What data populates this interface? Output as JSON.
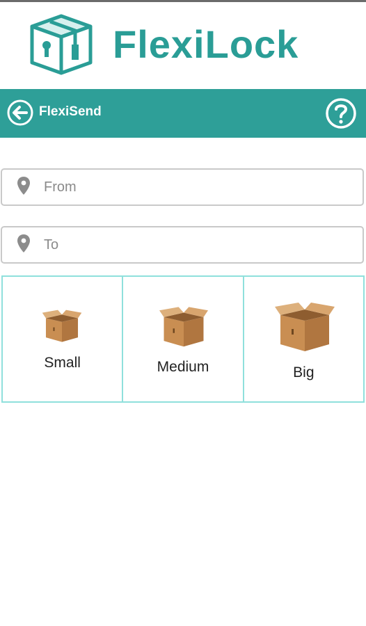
{
  "brand": {
    "name": "FlexiLock",
    "color": "#2a9d96"
  },
  "appbar": {
    "title": "FlexiSend",
    "back_icon": "arrow-left-circle-icon",
    "help_icon": "question-circle-icon",
    "color": "#2e9f98"
  },
  "form": {
    "from": {
      "placeholder": "From",
      "value": ""
    },
    "to": {
      "placeholder": "To",
      "value": ""
    }
  },
  "sizes": [
    {
      "label": "Small"
    },
    {
      "label": "Medium"
    },
    {
      "label": "Big"
    }
  ]
}
